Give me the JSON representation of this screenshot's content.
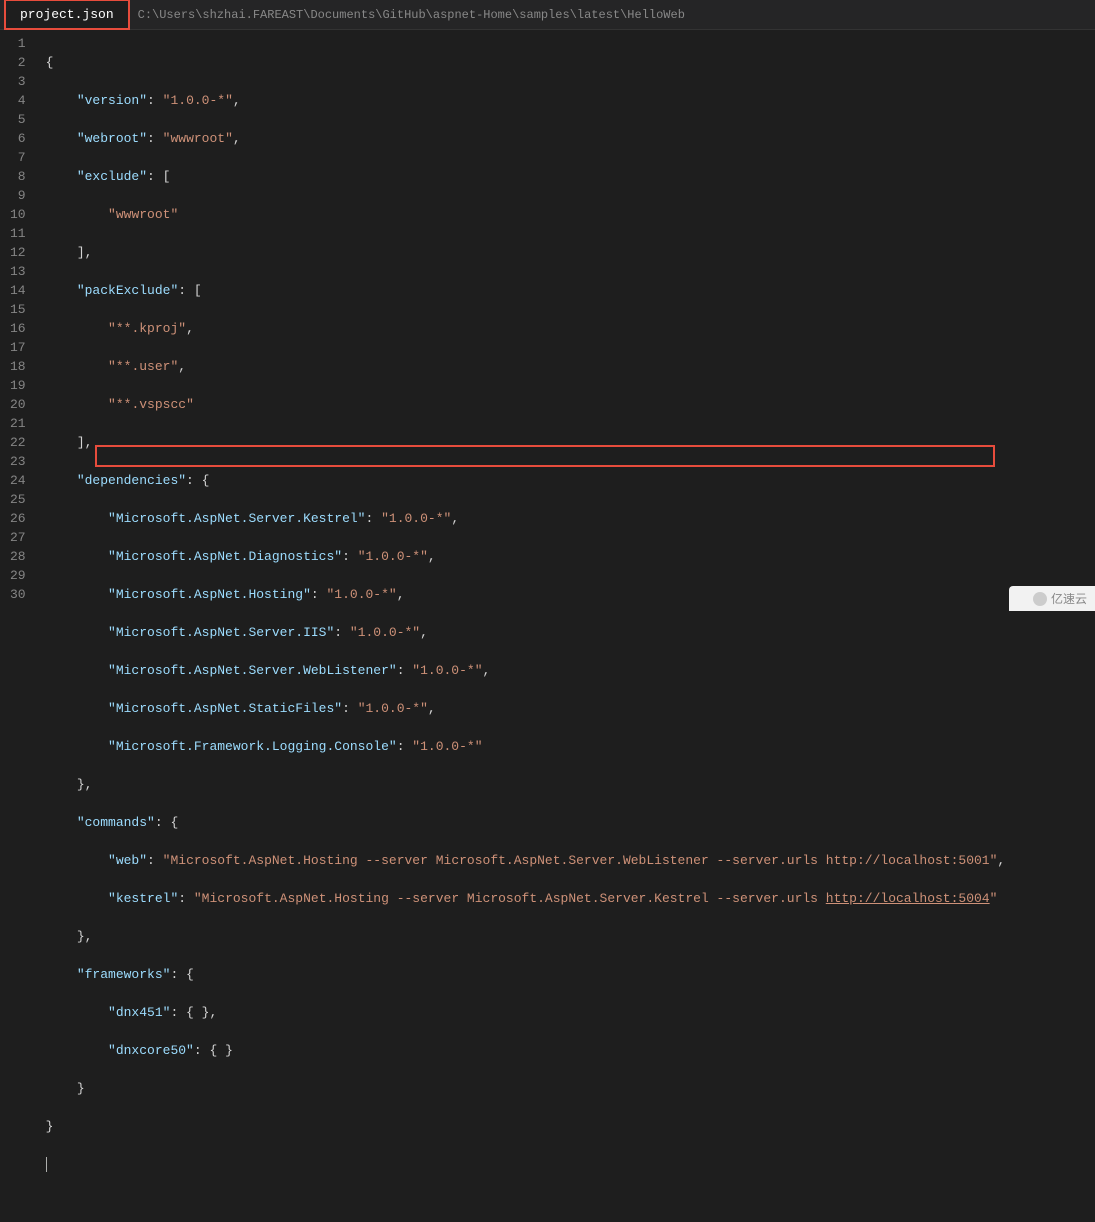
{
  "tab": {
    "filename": "project.json",
    "path": "C:\\Users\\shzhai.FAREAST\\Documents\\GitHub\\aspnet-Home\\samples\\latest\\HelloWeb"
  },
  "json_content": {
    "version": "1.0.0-*",
    "webroot": "wwwroot",
    "exclude": [
      "wwwroot"
    ],
    "packExclude": [
      "**.kproj",
      "**.user",
      "**.vspscc"
    ],
    "dependencies": {
      "Microsoft.AspNet.Server.Kestrel": "1.0.0-*",
      "Microsoft.AspNet.Diagnostics": "1.0.0-*",
      "Microsoft.AspNet.Hosting": "1.0.0-*",
      "Microsoft.AspNet.Server.IIS": "1.0.0-*",
      "Microsoft.AspNet.Server.WebListener": "1.0.0-*",
      "Microsoft.AspNet.StaticFiles": "1.0.0-*",
      "Microsoft.Framework.Logging.Console": "1.0.0-*"
    },
    "commands": {
      "web": "Microsoft.AspNet.Hosting --server Microsoft.AspNet.Server.WebListener --server.urls http://localhost:5001",
      "kestrel_prefix": "Microsoft.AspNet.Hosting --server Microsoft.AspNet.Server.Kestrel --server.urls ",
      "kestrel_url": "http://localhost:5004"
    },
    "frameworks": {
      "dnx451": {},
      "dnxcore50": {}
    }
  },
  "line_numbers": [
    "1",
    "2",
    "3",
    "4",
    "5",
    "6",
    "7",
    "8",
    "9",
    "10",
    "11",
    "12",
    "13",
    "14",
    "15",
    "16",
    "17",
    "18",
    "19",
    "20",
    "21",
    "22",
    "23",
    "24",
    "25",
    "26",
    "27",
    "28",
    "29",
    "30"
  ],
  "watermark": "亿速云"
}
